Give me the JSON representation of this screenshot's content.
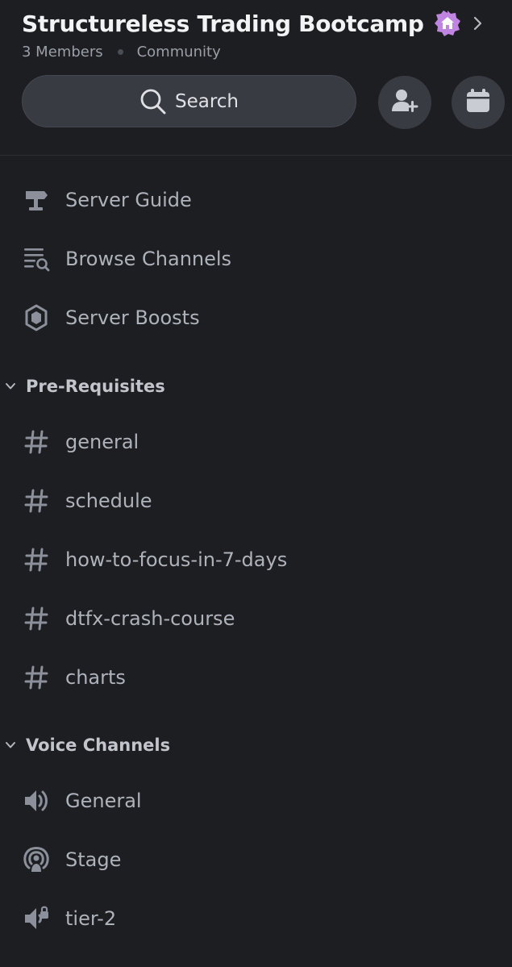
{
  "server": {
    "name": "Structureless Trading Bootcamp",
    "members": "3 Members",
    "type": "Community",
    "badge_color": "#c085e0"
  },
  "search": {
    "label": "Search"
  },
  "actions": {
    "invite_icon": "add-member-icon",
    "events_icon": "calendar-icon"
  },
  "menu": [
    {
      "label": "Server Guide",
      "icon": "signpost-icon"
    },
    {
      "label": "Browse Channels",
      "icon": "browse-channels-icon"
    },
    {
      "label": "Server Boosts",
      "icon": "boost-icon"
    }
  ],
  "categories": [
    {
      "name": "Pre-Requisites",
      "channels": [
        {
          "label": "general",
          "icon": "hash-icon"
        },
        {
          "label": "schedule",
          "icon": "hash-icon"
        },
        {
          "label": "how-to-focus-in-7-days",
          "icon": "hash-icon"
        },
        {
          "label": "dtfx-crash-course",
          "icon": "hash-icon"
        },
        {
          "label": "charts",
          "icon": "hash-icon"
        }
      ]
    },
    {
      "name": "Voice Channels",
      "channels": [
        {
          "label": "General",
          "icon": "speaker-icon"
        },
        {
          "label": "Stage",
          "icon": "stage-icon"
        },
        {
          "label": "tier-2",
          "icon": "speaker-locked-icon"
        }
      ]
    }
  ],
  "colors": {
    "background": "#1d1e22",
    "title": "#f2f3f5",
    "channel_text": "#aeb2ba",
    "icon": "#8c909a"
  }
}
